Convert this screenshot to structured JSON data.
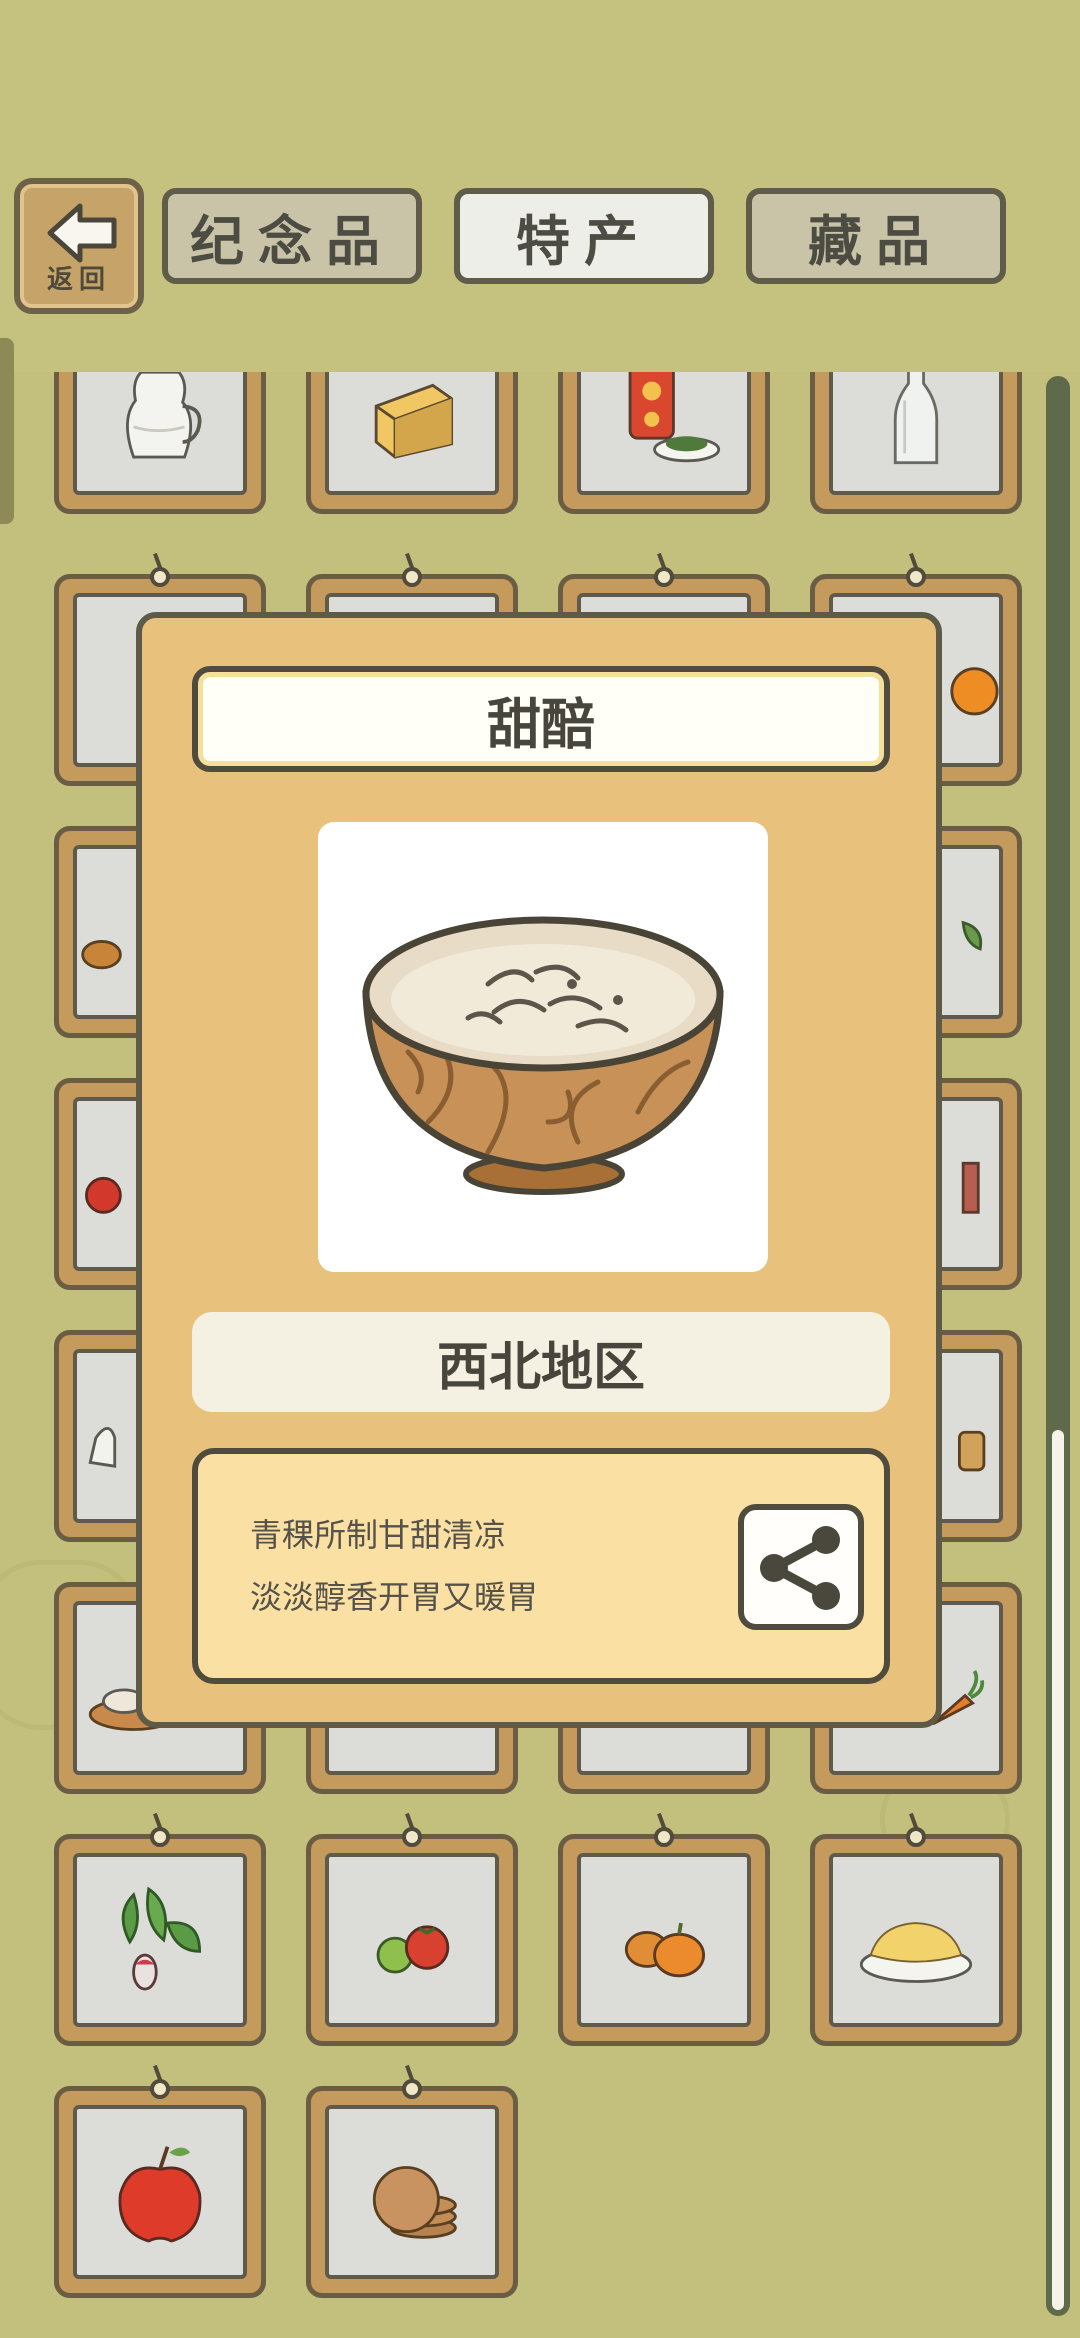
{
  "nav": {
    "back": {
      "icon": "back-arrow-icon",
      "label": "返回"
    },
    "tabs": [
      {
        "label": "纪念品",
        "active": false
      },
      {
        "label": "特产",
        "active": true
      },
      {
        "label": "藏品",
        "active": false
      }
    ]
  },
  "items": [
    {
      "icon": "milk-jug-icon"
    },
    {
      "icon": "cheese-wedge-icon"
    },
    {
      "icon": "tea-can-icon"
    },
    {
      "icon": "glass-bottle-icon"
    },
    {
      "icon": "covered-item-icon"
    },
    {
      "icon": "covered-item-icon"
    },
    {
      "icon": "covered-item-icon"
    },
    {
      "icon": "orange-icon"
    },
    {
      "icon": "covered-item-icon"
    },
    {
      "icon": "leaf-item-icon"
    },
    {
      "icon": "apple-icon"
    },
    {
      "icon": "covered-item-icon"
    },
    {
      "icon": "covered-item-icon"
    },
    {
      "icon": "basket-icon"
    },
    {
      "icon": "bread-icon"
    },
    {
      "icon": "carrot-icon"
    },
    {
      "icon": "radish-icon"
    },
    {
      "icon": "tomato-icon"
    },
    {
      "icon": "pumpkin-icon"
    },
    {
      "icon": "noodle-plate-icon"
    },
    {
      "icon": "red-apple-icon"
    },
    {
      "icon": "pancake-stack-icon"
    }
  ],
  "detail": {
    "title": "甜醅",
    "image": "wooden-bowl-icon",
    "region": "西北地区",
    "description": [
      "青稞所制甘甜清凉",
      "淡淡醇香开胃又暖胃"
    ],
    "share_icon": "share-icon"
  },
  "colors": {
    "background": "#c3bf7c",
    "modal": "#e8c27c",
    "card_frame": "#c49b5c",
    "outline": "#4f4c3d"
  }
}
